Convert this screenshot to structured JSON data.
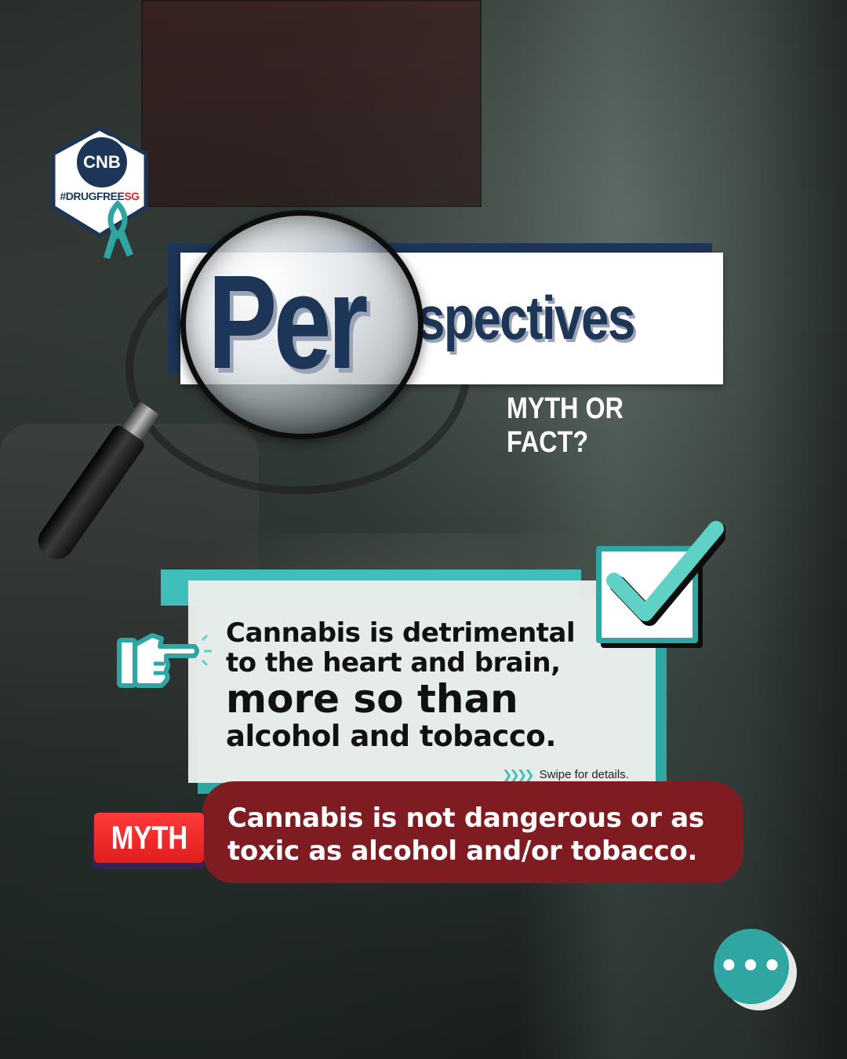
{
  "logo": {
    "org": "CNB",
    "hashtag_main": "#DRUGFREE",
    "hashtag_suffix": "SG"
  },
  "title": {
    "magnified": "Per",
    "rest": "spectives",
    "subtitle": "MYTH OR FACT?"
  },
  "fact": {
    "line1": "Cannabis is detrimental",
    "line2": "to the heart and brain,",
    "line3": "more so than",
    "line4": "alcohol and tobacco.",
    "swipe_arrows": "❯❯❯❯",
    "swipe_label": "Swipe for details."
  },
  "myth": {
    "tag": "MYTH",
    "text": "Cannabis is not dangerous or as toxic as alcohol and/or tobacco."
  },
  "more_button": {
    "label": "•••"
  },
  "colors": {
    "navy": "#1d3557",
    "teal": "#3fbfbc",
    "teal_dark": "#2fa6a2",
    "myth_red": "#e01e1e",
    "myth_pill": "#7e1c22"
  },
  "icons": [
    "magnifier-icon",
    "checkmark-icon",
    "pointing-hand-icon",
    "ribbon-icon",
    "more-icon"
  ]
}
